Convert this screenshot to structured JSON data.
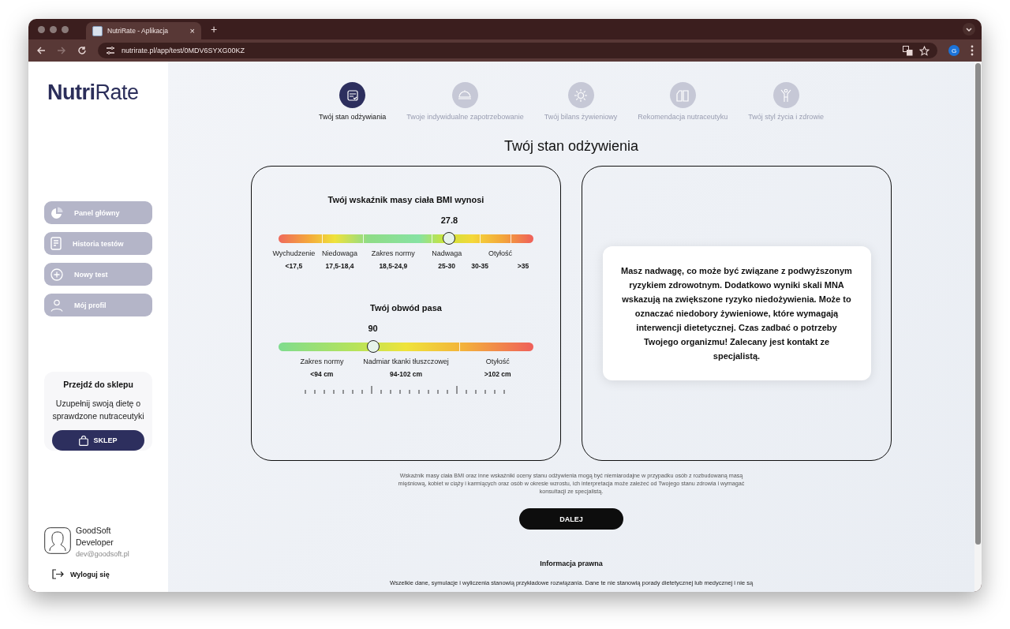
{
  "browser": {
    "tab_title": "NutriRate - Aplikacja",
    "tab_close": "×",
    "new_tab": "+",
    "url": "nutrirate.pl/app/test/0MDV6SYXG00KZ",
    "profile_initial": "G"
  },
  "sidebar": {
    "logo": {
      "part_1": "Nutri",
      "part_2": "Rate"
    },
    "items": [
      {
        "label": "Panel główny",
        "kind": "pie"
      },
      {
        "label": "Historia testów",
        "kind": "document"
      },
      {
        "label": "Nowy test",
        "kind": "plus"
      },
      {
        "label": "Mój profil",
        "kind": "person"
      }
    ],
    "shop": {
      "title": "Przejdź do sklepu",
      "text": "Uzupełnij swoją dietę o sprawdzone nutraceutyki",
      "button": "SKLEP"
    },
    "user": {
      "name": "GoodSoft Developer",
      "email": "dev@goodsoft.pl"
    },
    "logout": "Wyloguj się"
  },
  "steps": [
    {
      "label": "Twój stan odżywiania",
      "selected": true,
      "kind": "checklist"
    },
    {
      "label": "Twoje indywidualne zapotrzebowanie",
      "selected": false,
      "kind": "cloche"
    },
    {
      "label": "Twój bilans żywieniowy",
      "selected": false,
      "kind": "sun"
    },
    {
      "label": "Rekomendacja nutraceutyku",
      "selected": false,
      "kind": "boxes"
    },
    {
      "label": "Twój styl życia i zdrowie",
      "selected": false,
      "kind": "figure"
    }
  ],
  "page_title": "Twój stan odżywienia",
  "bmi": {
    "title": "Twój wskaźnik masy ciała BMI wynosi",
    "reading": "27.8",
    "level": 0.67,
    "labels": [
      "Wychudzenie",
      "Niedowaga",
      "Zakres normy",
      "Nadwaga",
      "Otyłość"
    ],
    "values": [
      "<17,5",
      "17,5-18,4",
      "18,5-24,9",
      "25-30",
      "30-35",
      ">35"
    ]
  },
  "waist": {
    "title": "Twój obwód pasa",
    "reading": "90",
    "level": 0.37,
    "labels": [
      "Zakres normy",
      "Nadmiar tkanki tłuszczowej",
      "Otyłość"
    ],
    "values": [
      "<94 cm",
      "94-102 cm",
      ">102 cm"
    ]
  },
  "message": "Masz nadwagę, co może być związane z podwyższonym ryzykiem zdrowotnym. Dodatkowo wyniki skali MNA wskazują na zwiększone ryzyko niedożywienia. Może to oznaczać niedobory żywieniowe, które wymagają interwencji dietetycznej. Czas zadbać o potrzeby Twojego organizmu! Zalecany jest kontakt ze specjalistą.",
  "disclaimer": "Wskaźnik masy ciała BMI oraz inne wskaźniki oceny stanu odżywienia mogą być niemiarodajne w przypadku osób z rozbudowaną masą mięśniową, kobiet w ciąży i karmiących oraz osób w okresie wzrostu, ich interpretacja może zależeć od Twojego stanu zdrowia i wymagać konsultacji ze specjalistą.",
  "next_button": "DALEJ",
  "legal": {
    "title": "Informacja prawna",
    "text": "Wszelkie dane, symulacje i wyliczenia stanowią przykładowe rozwiązania. Dane te nie stanowią porady dietetycznej lub medycznej i nie są"
  }
}
